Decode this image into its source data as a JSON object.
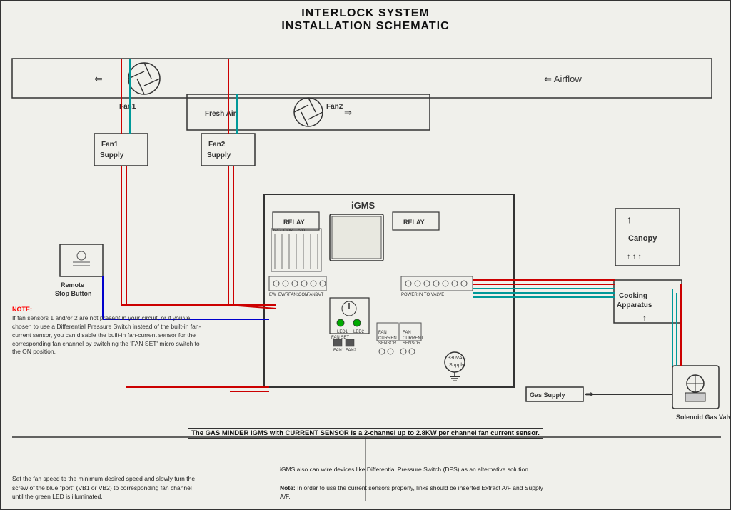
{
  "title": {
    "line1": "INTERLOCK SYSTEM",
    "line2": "INSTALLATION SCHEMATIC"
  },
  "labels": {
    "fan1": "Fan1",
    "fan1_supply": "Fan1\nSupply",
    "fan2": "Fan2",
    "fan2_supply": "Fan2\nSupply",
    "fresh_air": "Fresh Air",
    "airflow": "Airflow",
    "igms": "iGMS",
    "relay": "RELAY",
    "relay2": "RELAY",
    "remote_stop": "Remote\nStop Button",
    "canopy": "Canopy",
    "cooking_apparatus": "Cooking\nApparatus",
    "gas_supply": "Gas Supply",
    "solenoid": "Solenoid Gas Valve",
    "supply_330vac": "330VAC\nSupply",
    "bottom_bar": "The GAS MINDER iGMS with CURRENT SENSOR is a 2-channel up to 2.8KW per channel fan current sensor.",
    "footer_left": "Set the fan speed to the minimum desired speed and slowly turn the\nscrew of the  blue \"port\" (VB1 or VB2) to corresponding fan channel\nuntil the green LED is illuminated.",
    "footer_right_1": "iGMS also can wire devices like Differential Pressure Switch (DPS) as\nan alternative solution.",
    "footer_right_2": "Note: In order to use the current sensors properly, links should be\ninserted Extract A/F and Supply A/F.",
    "note_label": "NOTE:",
    "note_body": "If fan sensors 1 and/or 2 are not present in your circuit, or if you've chosen to use a Differential Pressure Switch instead of the built-in fan-current sensor, you can disable the built-in fan-current sensor for the corresponding fan channel by switching the 'FAN SET' micro switch to the ON position."
  },
  "colors": {
    "red": "#cc0000",
    "teal": "#009999",
    "blue": "#0000cc",
    "green": "#00aa00",
    "black": "#111111",
    "dark": "#333333"
  }
}
